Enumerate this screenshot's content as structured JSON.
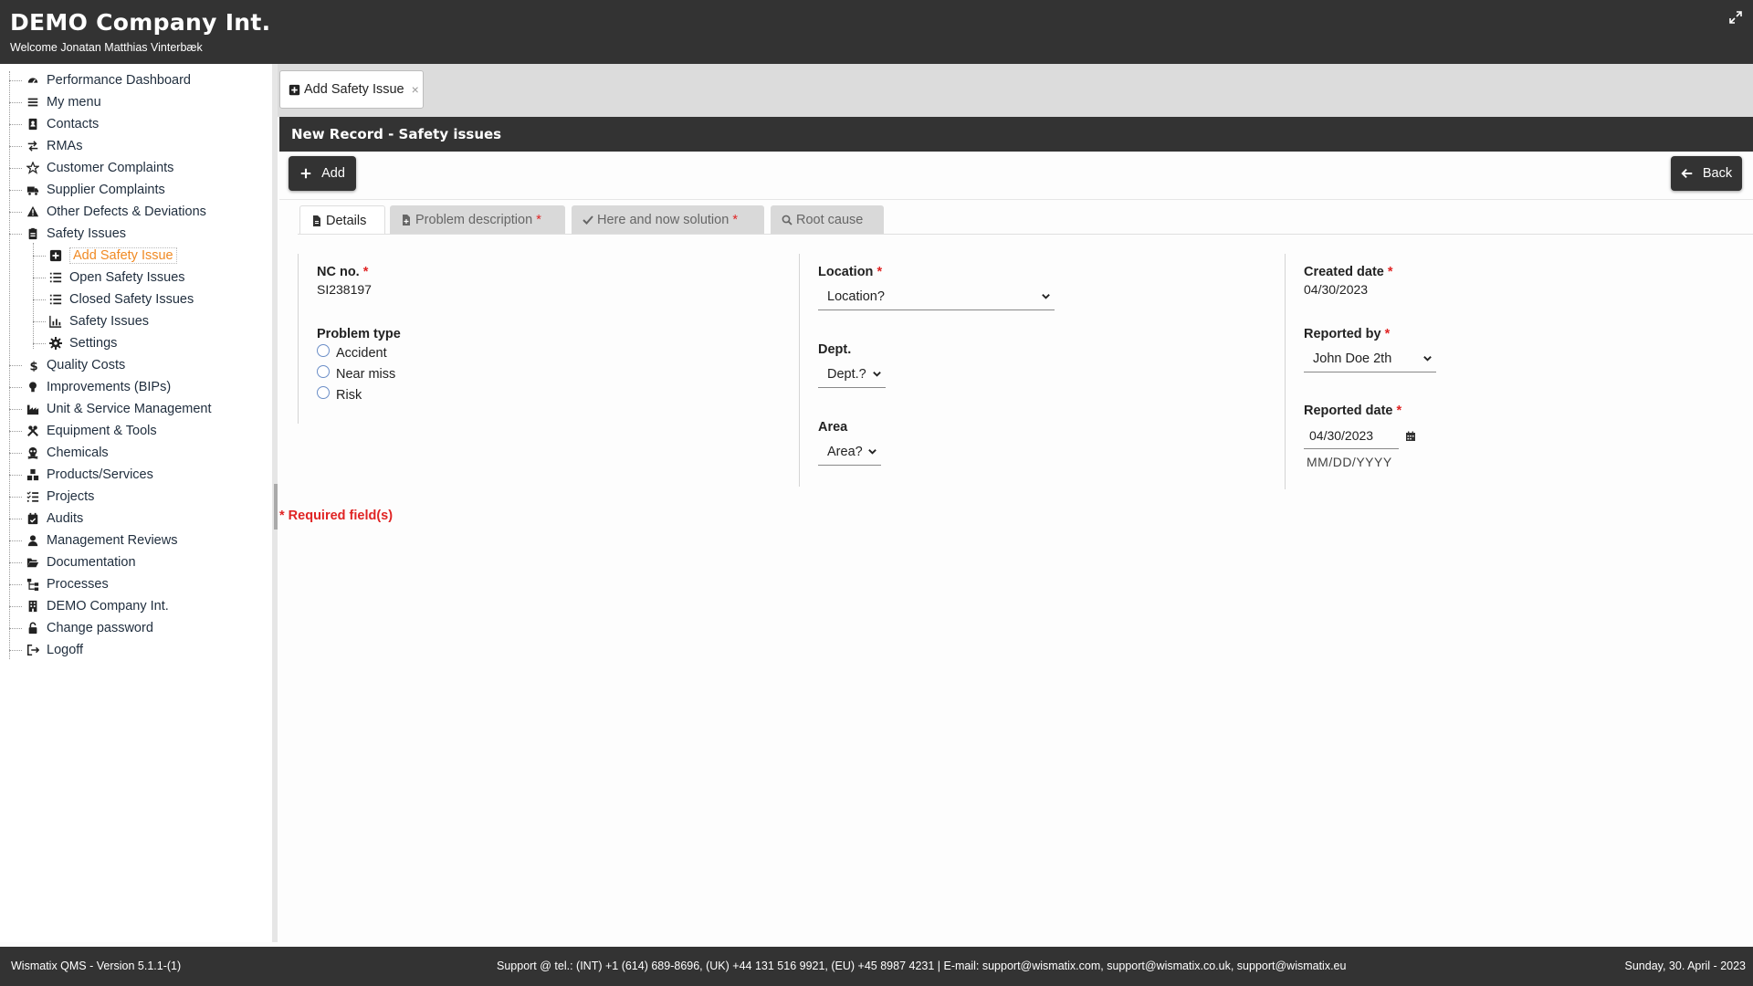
{
  "header": {
    "company": "DEMO Company Int.",
    "welcome": "Welcome Jonatan Matthias Vinterbæk"
  },
  "sidebar": {
    "items": [
      {
        "label": "Performance Dashboard",
        "icon": "gauge-icon"
      },
      {
        "label": "My menu",
        "icon": "menu-icon"
      },
      {
        "label": "Contacts",
        "icon": "address-book-icon"
      },
      {
        "label": "RMAs",
        "icon": "exchange-icon"
      },
      {
        "label": "Customer Complaints",
        "icon": "star-icon"
      },
      {
        "label": "Supplier Complaints",
        "icon": "truck-icon"
      },
      {
        "label": "Other Defects & Deviations",
        "icon": "warning-icon"
      },
      {
        "label": "Safety Issues",
        "icon": "clipboard-icon"
      },
      {
        "label": "Add Safety Issue",
        "icon": "plus-square-icon"
      },
      {
        "label": "Open Safety Issues",
        "icon": "list-icon"
      },
      {
        "label": "Closed Safety Issues",
        "icon": "list-icon"
      },
      {
        "label": "Safety Issues",
        "icon": "chart-icon"
      },
      {
        "label": "Settings",
        "icon": "gear-icon"
      },
      {
        "label": "Quality Costs",
        "icon": "dollar-icon"
      },
      {
        "label": "Improvements (BIPs)",
        "icon": "lightbulb-icon"
      },
      {
        "label": "Unit & Service Management",
        "icon": "factory-icon"
      },
      {
        "label": "Equipment & Tools",
        "icon": "tools-icon"
      },
      {
        "label": "Chemicals",
        "icon": "skull-icon"
      },
      {
        "label": "Products/Services",
        "icon": "boxes-icon"
      },
      {
        "label": "Projects",
        "icon": "tasks-icon"
      },
      {
        "label": "Audits",
        "icon": "calendar-check-icon"
      },
      {
        "label": "Management Reviews",
        "icon": "user-icon"
      },
      {
        "label": "Documentation",
        "icon": "folder-open-icon"
      },
      {
        "label": "Processes",
        "icon": "sitemap-icon"
      },
      {
        "label": "DEMO Company Int.",
        "icon": "building-icon"
      },
      {
        "label": "Change password",
        "icon": "unlock-icon"
      },
      {
        "label": "Logoff",
        "icon": "sign-out-icon"
      }
    ]
  },
  "doc_tab": {
    "label": "Add Safety Issue",
    "close": "×"
  },
  "record": {
    "title": "New Record - Safety issues"
  },
  "toolbar": {
    "add_label": "Add",
    "back_label": "Back"
  },
  "form_tabs": {
    "details": "Details",
    "problem_description": "Problem description",
    "here_and_now": "Here and now solution",
    "root_cause": "Root cause",
    "required_mark": "*"
  },
  "form": {
    "nc_no_label": "NC no.",
    "nc_no_value": "SI238197",
    "problem_type_label": "Problem type",
    "problem_types": [
      "Accident",
      "Near miss",
      "Risk"
    ],
    "location_label": "Location",
    "location_value": "Location?",
    "dept_label": "Dept.",
    "dept_value": "Dept.?",
    "area_label": "Area",
    "area_value": "Area?",
    "created_date_label": "Created date",
    "created_date_value": "04/30/2023",
    "reported_by_label": "Reported by",
    "reported_by_value": "John Doe 2th",
    "reported_date_label": "Reported date",
    "reported_date_value": "04/30/2023",
    "reported_date_hint": "MM/DD/YYYY",
    "required_note": "* Required field(s)"
  },
  "footer": {
    "version": "Wismatix QMS - Version 5.1.1-(1)",
    "support": "Support @ tel.: (INT) +1 (614) 689-8696, (UK) +44 131 516 9921, (EU) +45 8987 4231 | E-mail: support@wismatix.com, support@wismatix.co.uk, support@wismatix.eu",
    "date": "Sunday, 30. April - 2023"
  },
  "colors": {
    "dark": "#333333",
    "accent": "#f08a24",
    "required": "#e02424"
  }
}
